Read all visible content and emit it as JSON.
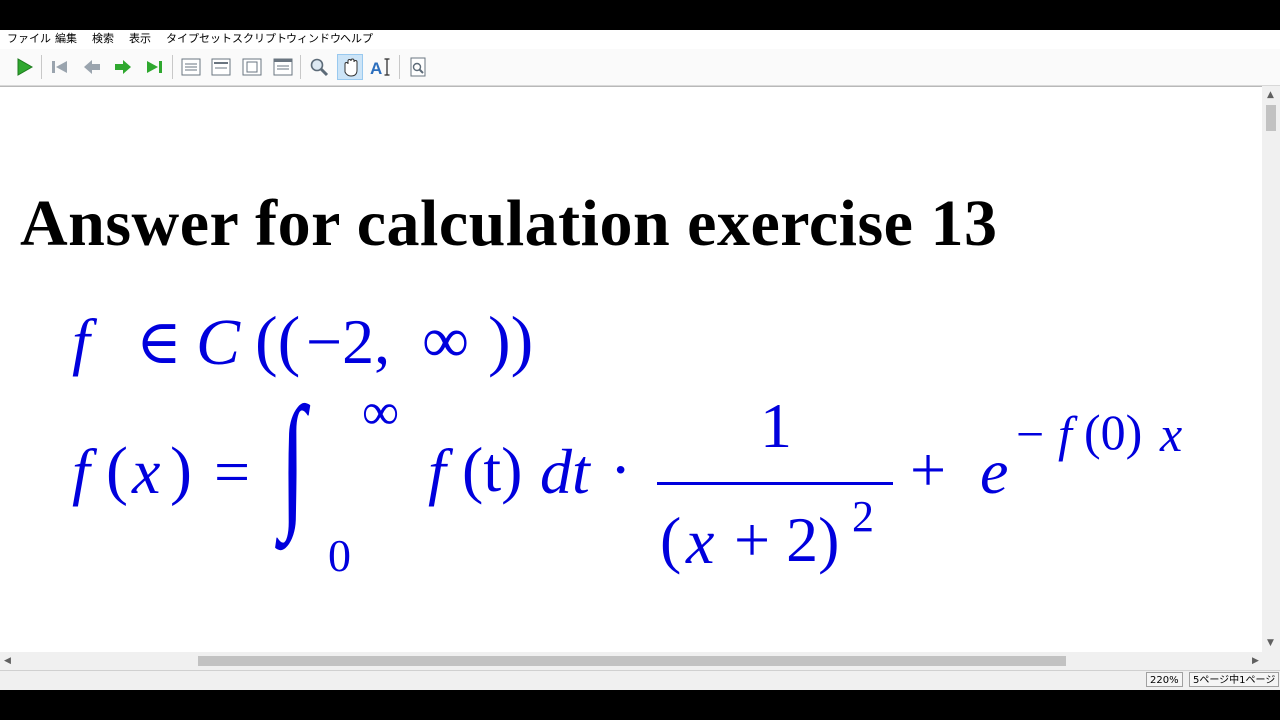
{
  "menu": [
    "ファイル",
    "編集",
    "検索",
    "表示",
    "タイプセット",
    "スクリプト",
    "ウィンドウ",
    "ヘルプ"
  ],
  "toolbar": {
    "buttons": [
      "typeset-icon",
      "first-page-icon",
      "previous-page-icon",
      "next-page-icon",
      "last-page-icon",
      "actual-size-icon",
      "fit-width-icon",
      "fit-page-icon",
      "fit-window-icon",
      "magnify-icon",
      "hand-tool-icon",
      "text-select-icon",
      "find-icon"
    ]
  },
  "document": {
    "title": "Answer for calculation exercise 13",
    "eq1": {
      "f": "f",
      "in": "∈",
      "C": "C",
      "open": "((",
      "minus2": "−2,",
      "inf": "∞",
      "close": "))"
    },
    "eq2": {
      "f": "f",
      "lp": "(",
      "x": "x",
      "rp": ")",
      "eq": "=",
      "integral": "∫",
      "upper": "∞",
      "lower": "0",
      "integrand_f": "f",
      "integrand_t": "(t)",
      "dt": "dt",
      "cdot": "·",
      "numerator": "1",
      "den_lp": "(",
      "den_x": "x",
      "den_plus": "+ 2)",
      "den_exp": "2",
      "plus": "+",
      "e": "e",
      "exp_minus": "−",
      "exp_f": "f",
      "exp_0": "(0)",
      "exp_x": "x"
    }
  },
  "status": {
    "zoom": "220%",
    "page": "5ページ中1ページ"
  },
  "colors": {
    "math": "#0000dd",
    "title": "#000000"
  }
}
